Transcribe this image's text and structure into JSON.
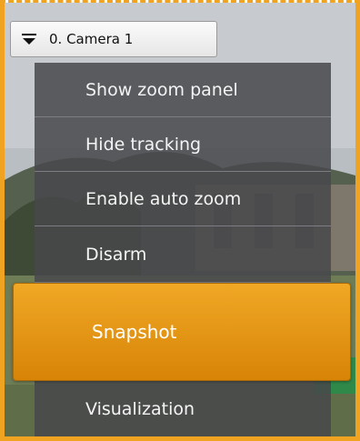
{
  "camera": {
    "title": "0. Camera 1",
    "menu_icon": "caret-down-icon"
  },
  "context_menu": {
    "items": [
      {
        "label": "Show zoom panel"
      },
      {
        "label": "Hide tracking"
      },
      {
        "label": "Enable auto zoom"
      },
      {
        "label": "Disarm"
      },
      {
        "label": "Snapshot",
        "highlighted": true
      },
      {
        "label": "Visualization"
      }
    ]
  },
  "colors": {
    "frame_accent": "#f0a221",
    "highlight": "#e89511",
    "menu_background": "#48484c"
  }
}
